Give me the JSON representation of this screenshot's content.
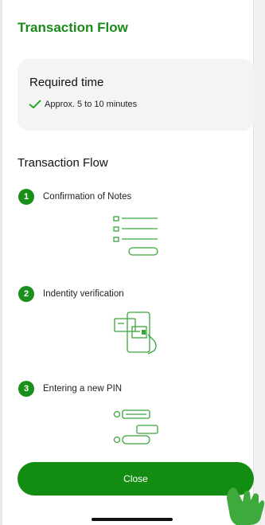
{
  "header": {
    "title": "Transaction Flow"
  },
  "required_time": {
    "title": "Required time",
    "text": "Approx. 5 to 10 minutes",
    "check_color": "#2aa52a"
  },
  "flow": {
    "title": "Transaction Flow",
    "steps": [
      {
        "number": "1",
        "label": "Confirmation of Notes",
        "icon": "document-checklist-icon"
      },
      {
        "number": "2",
        "label": "Indentity verification",
        "icon": "id-card-phone-icon"
      },
      {
        "number": "3",
        "label": "Entering a new PIN",
        "icon": "pin-entry-icon"
      }
    ]
  },
  "footer": {
    "close_label": "Close"
  },
  "colors": {
    "accent": "#128d12",
    "title": "#1b8a1b",
    "card_bg": "#f4f4f4"
  }
}
